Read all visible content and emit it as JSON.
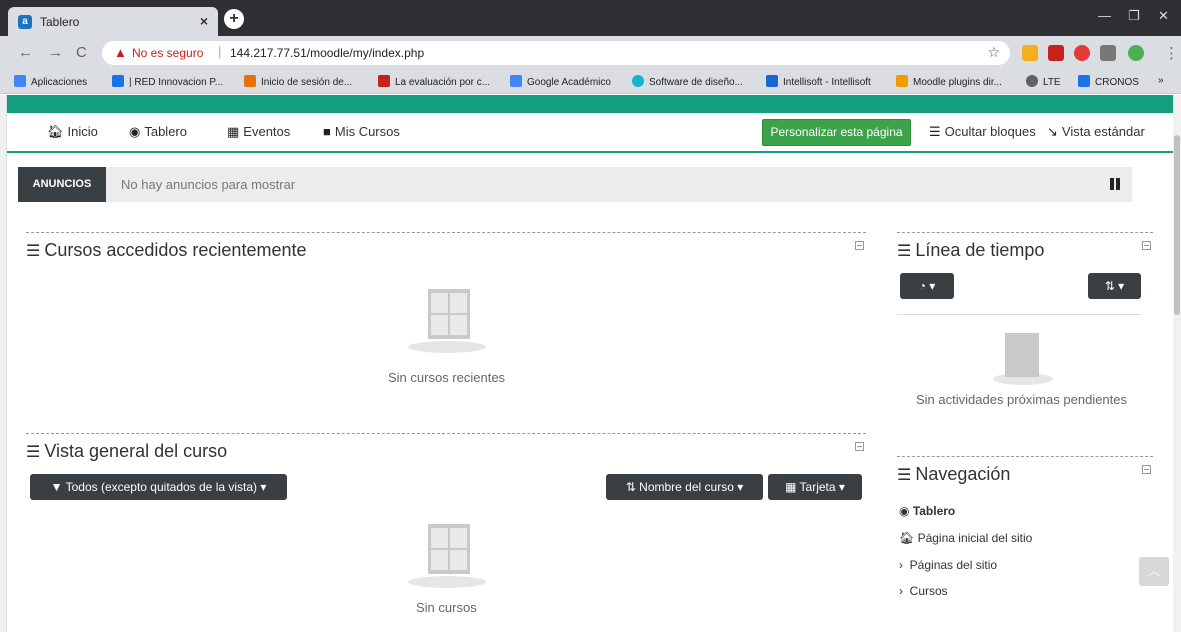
{
  "browser": {
    "tab_title": "Tablero",
    "security_label": "No es seguro",
    "url": "144.217.77.51/moodle/my/index.php",
    "bookmarks": [
      {
        "label": "Aplicaciones",
        "color": "#4285f4"
      },
      {
        "label": "| RED Innovacion P...",
        "color": "#1a73e8"
      },
      {
        "label": "Inicio de sesión de...",
        "color": "#e8710a"
      },
      {
        "label": "La evaluación por c...",
        "color": "#c5221f"
      },
      {
        "label": "Google Académico",
        "color": "#4285f4"
      },
      {
        "label": "Software de diseño...",
        "color": "#12b5cb"
      },
      {
        "label": "Intellisoft - Intellisoft",
        "color": "#1967d2"
      },
      {
        "label": "Moodle plugins dir...",
        "color": "#f29900"
      },
      {
        "label": "LTE",
        "color": "#5f6368"
      },
      {
        "label": "CRONOS",
        "color": "#1a73e8"
      }
    ]
  },
  "nav": {
    "items": [
      "Inicio",
      "Tablero",
      "Eventos",
      "Mis Cursos"
    ],
    "customize": "Personalizar esta página",
    "hide_blocks": "Ocultar bloques",
    "standard_view": "Vista estándar"
  },
  "announcements": {
    "label": "ANUNCIOS",
    "text": "No hay anuncios para mostrar"
  },
  "recent": {
    "title": "Cursos accedidos recientemente",
    "empty": "Sin cursos recientes"
  },
  "overview": {
    "title": "Vista general del curso",
    "filter": "Todos (excepto quitados de la vista)",
    "sort": "Nombre del curso",
    "view": "Tarjeta",
    "empty": "Sin cursos"
  },
  "timeline": {
    "title": "Línea de tiempo",
    "empty": "Sin actividades próximas pendientes"
  },
  "navigation": {
    "title": "Navegación",
    "items": [
      "Tablero",
      "Página inicial del sitio",
      "Páginas del sitio",
      "Cursos"
    ]
  },
  "colors": {
    "accent": "#139e7e",
    "customize_btn": "#3ca34a",
    "dark_btn": "#3a3f44"
  }
}
